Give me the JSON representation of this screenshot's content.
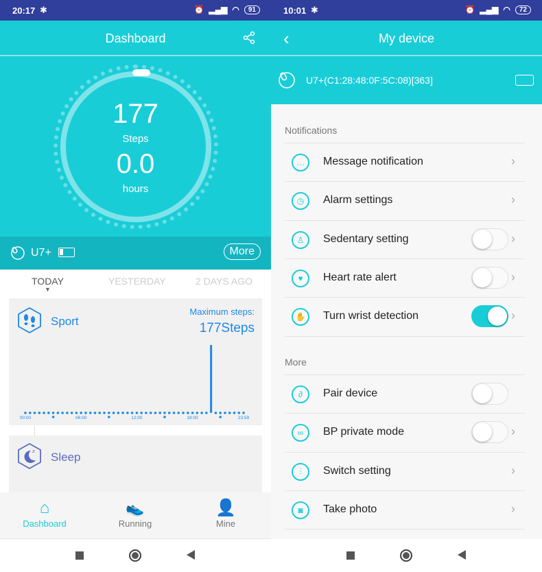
{
  "left": {
    "status": {
      "time": "20:17",
      "battery": "91"
    },
    "header": {
      "title": "Dashboard",
      "share_icon": "share-icon"
    },
    "summary": {
      "steps": "177",
      "steps_label": "Steps",
      "hours": "0.0",
      "hours_label": "hours"
    },
    "device": {
      "name": "U7+",
      "more_label": "More"
    },
    "tabs": [
      "TODAY",
      "YESTERDAY",
      "2 DAYS AGO"
    ],
    "sport": {
      "title": "Sport",
      "max_label": "Maximum steps:",
      "max_value": "177Steps"
    },
    "sleep": {
      "title": "Sleep"
    },
    "bottom_nav": [
      {
        "label": "Dashboard",
        "active": true
      },
      {
        "label": "Running"
      },
      {
        "label": "Mine"
      }
    ]
  },
  "right": {
    "status": {
      "time": "10:01",
      "battery": "72"
    },
    "header": {
      "title": "My device"
    },
    "device": {
      "id": "U7+(C1:28:48:0F:5C:08)[363]"
    },
    "sections": [
      {
        "title": "Notifications",
        "items": [
          {
            "label": "Message notification",
            "icon": "message-icon",
            "toggle": null
          },
          {
            "label": "Alarm settings",
            "icon": "alarm-icon",
            "toggle": null
          },
          {
            "label": "Sedentary setting",
            "icon": "sedentary-icon",
            "toggle": false
          },
          {
            "label": "Heart rate alert",
            "icon": "heart-rate-icon",
            "toggle": false
          },
          {
            "label": "Turn wrist detection",
            "icon": "wrist-icon",
            "toggle": true
          }
        ]
      },
      {
        "title": "More",
        "items": [
          {
            "label": "Pair device",
            "icon": "link-icon",
            "toggle": false,
            "nochev": true
          },
          {
            "label": "BP private mode",
            "icon": "bp-icon",
            "toggle": false
          },
          {
            "label": "Switch setting",
            "icon": "sliders-icon",
            "toggle": null
          },
          {
            "label": "Take photo",
            "icon": "camera-icon",
            "toggle": null
          }
        ]
      }
    ]
  },
  "colors": {
    "accent": "#19cdd7",
    "status_bar": "#303e9c",
    "sport": "#1e88e5",
    "sleep": "#5c6bc0"
  },
  "chart_data": {
    "type": "bar",
    "title": "",
    "x_tick_labels": [
      "00:00",
      "06:00",
      "12:00",
      "18:00",
      "23:59"
    ],
    "interval": "30 min",
    "values": [
      0,
      0,
      0,
      0,
      0,
      0,
      0,
      0,
      0,
      0,
      0,
      0,
      0,
      0,
      0,
      0,
      0,
      0,
      0,
      0,
      0,
      0,
      0,
      0,
      0,
      0,
      0,
      0,
      0,
      0,
      0,
      0,
      0,
      0,
      0,
      0,
      0,
      0,
      0,
      0,
      177,
      0,
      0,
      0,
      0,
      0,
      0,
      0
    ],
    "ylim": [
      0,
      177
    ]
  }
}
